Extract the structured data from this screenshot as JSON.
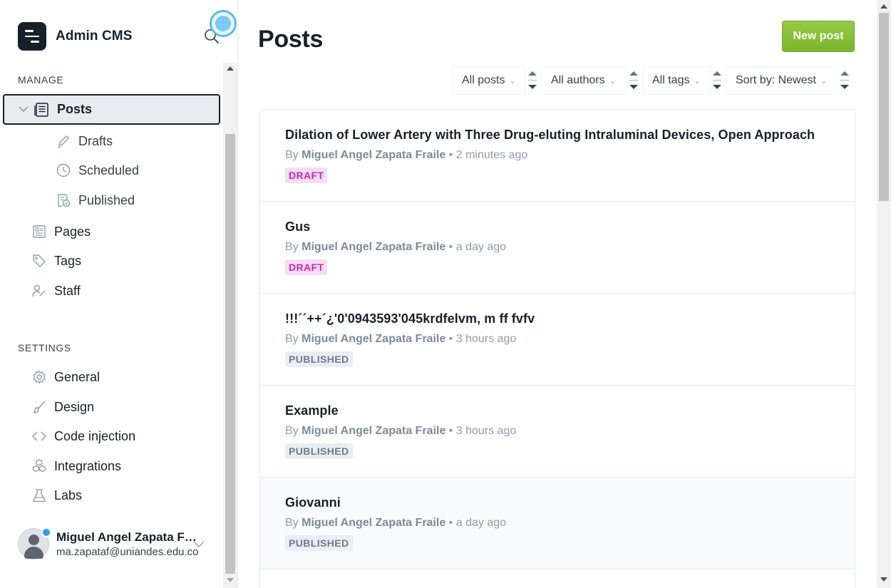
{
  "brand": {
    "name": "Admin CMS"
  },
  "sidebar": {
    "manage_label": "MANAGE",
    "settings_label": "SETTINGS",
    "posts": {
      "label": "Posts",
      "icon": "posts-icon"
    },
    "post_subitems": [
      {
        "label": "Drafts",
        "icon": "pencil-icon"
      },
      {
        "label": "Scheduled",
        "icon": "clock-icon"
      },
      {
        "label": "Published",
        "icon": "published-icon"
      }
    ],
    "manage_items": [
      {
        "label": "Pages",
        "icon": "pages-icon"
      },
      {
        "label": "Tags",
        "icon": "tag-icon"
      },
      {
        "label": "Staff",
        "icon": "staff-icon"
      }
    ],
    "settings_items": [
      {
        "label": "General",
        "icon": "gear-icon"
      },
      {
        "label": "Design",
        "icon": "brush-icon"
      },
      {
        "label": "Code injection",
        "icon": "code-icon"
      },
      {
        "label": "Integrations",
        "icon": "integrations-icon"
      },
      {
        "label": "Labs",
        "icon": "flask-icon"
      }
    ]
  },
  "user": {
    "name": "Miguel Angel Zapata Fraile",
    "email": "ma.zapataf@uniandes.edu.co"
  },
  "main": {
    "title": "Posts",
    "new_post_label": "New post",
    "filters": [
      "All posts",
      "All authors",
      "All tags",
      "Sort by: Newest"
    ]
  },
  "posts": [
    {
      "title": "Dilation of Lower Artery with Three Drug-eluting Intraluminal Devices, Open Approach",
      "by": "By",
      "author": "Miguel Angel Zapata Fraile",
      "time": "2 minutes ago",
      "status": "DRAFT"
    },
    {
      "title": "Gus",
      "by": "By",
      "author": "Miguel Angel Zapata Fraile",
      "time": "a day ago",
      "status": "DRAFT"
    },
    {
      "title": "!!!´´++´¿'0'0943593'045krdfelvm, m ff fvfv",
      "by": "By",
      "author": "Miguel Angel Zapata Fraile",
      "time": "3 hours ago",
      "status": "PUBLISHED"
    },
    {
      "title": "Example",
      "by": "By",
      "author": "Miguel Angel Zapata Fraile",
      "time": "3 hours ago",
      "status": "PUBLISHED"
    },
    {
      "title": "Giovanni",
      "by": "By",
      "author": "Miguel Angel Zapata Fraile",
      "time": "a day ago",
      "status": "PUBLISHED"
    }
  ],
  "colors": {
    "accent": "#8ac23a",
    "draft": "#c229b6",
    "published": "#6c7b8a",
    "focus": "#5cb7f0"
  }
}
